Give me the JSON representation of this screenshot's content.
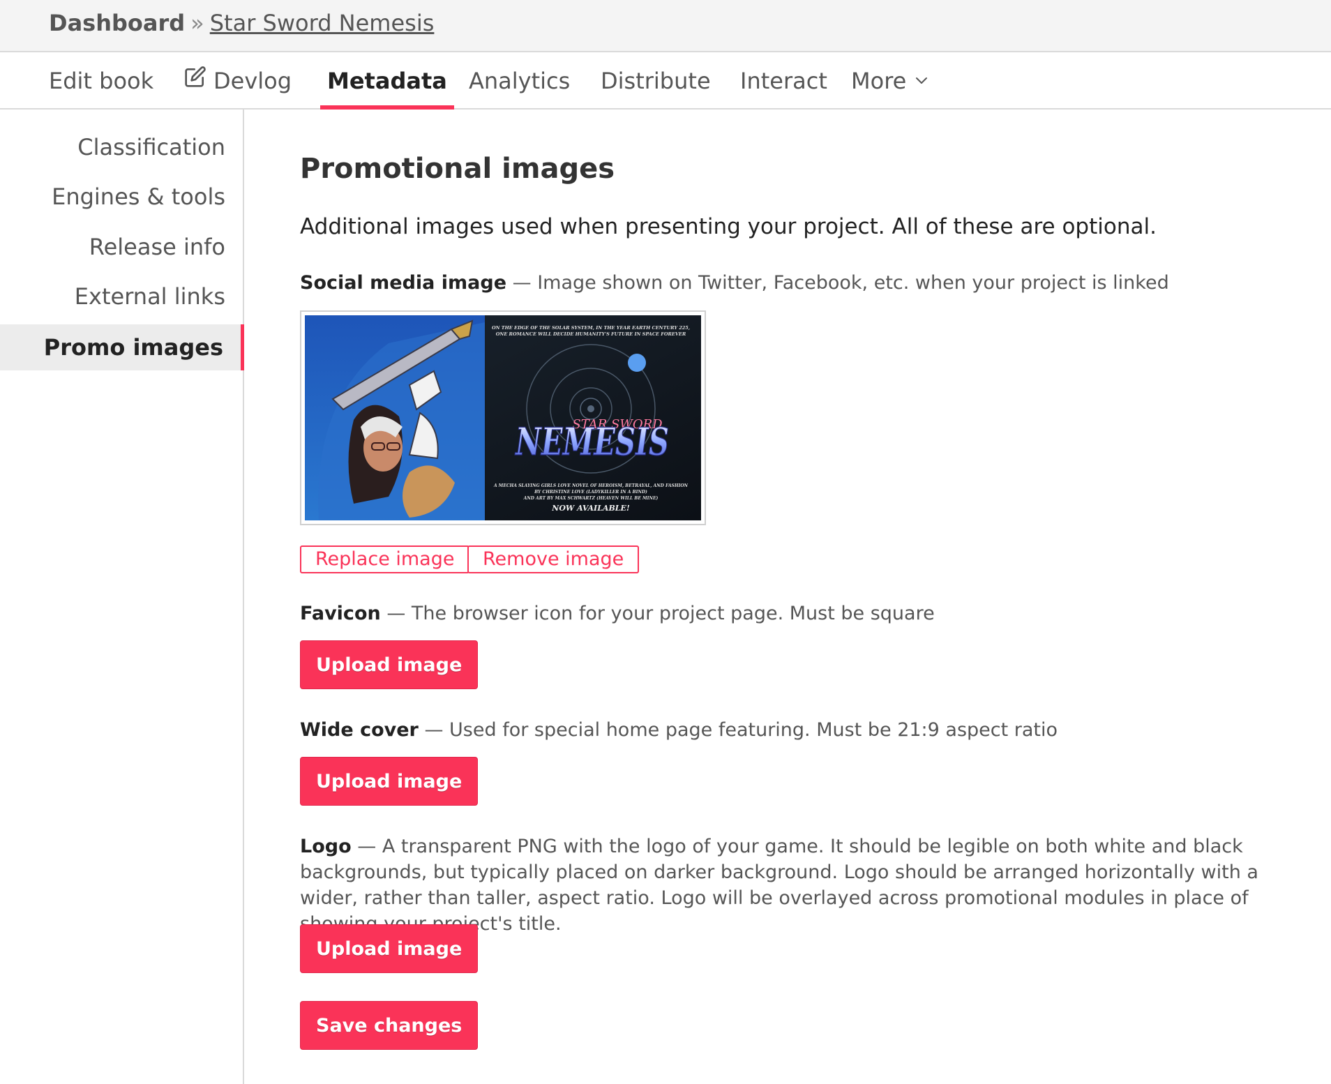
{
  "breadcrumb": {
    "home": "Dashboard",
    "separator": "»",
    "current": "Star Sword Nemesis"
  },
  "tabs": [
    {
      "label": "Edit book",
      "active": false
    },
    {
      "label": "Devlog",
      "active": false,
      "icon": "edit-icon"
    },
    {
      "label": "Metadata",
      "active": true
    },
    {
      "label": "Analytics",
      "active": false
    },
    {
      "label": "Distribute",
      "active": false
    },
    {
      "label": "Interact",
      "active": false
    },
    {
      "label": "More",
      "active": false,
      "icon": "chevron-down-icon"
    }
  ],
  "sidebar": {
    "items": [
      {
        "label": "Classification",
        "active": false
      },
      {
        "label": "Engines & tools",
        "active": false
      },
      {
        "label": "Release info",
        "active": false
      },
      {
        "label": "External links",
        "active": false
      },
      {
        "label": "Promo images",
        "active": true
      }
    ]
  },
  "main": {
    "title": "Promotional images",
    "description": "Additional images used when presenting your project. All of these are optional.",
    "social_media": {
      "name": "Social media image",
      "description": "— Image shown on Twitter, Facebook, etc. when your project is linked",
      "image": {
        "tagline_top_1": "ON THE EDGE OF THE SOLAR SYSTEM, IN THE YEAR EARTH CENTURY 225,",
        "tagline_top_2": "ONE ROMANCE WILL DECIDE HUMANITY'S FUTURE IN SPACE FOREVER",
        "title_small": "STAR SWORD",
        "title_big": "NEMESIS",
        "credit_1": "A MECHA SLAYING GIRLS LOVE NOVEL OF HEROISM, BETRAYAL, AND FASHION",
        "credit_2": "BY CHRISTINE LOVE (LADYKILLER IN A BIND)",
        "credit_3": "AND ART BY MAX SCHWARTZ (HEAVEN WILL BE MINE)",
        "availability": "NOW AVAILABLE!"
      },
      "replace_label": "Replace image",
      "remove_label": "Remove image"
    },
    "favicon": {
      "name": "Favicon",
      "description": "— The browser icon for your project page. Must be square",
      "upload_label": "Upload image"
    },
    "wide_cover": {
      "name": "Wide cover",
      "description": "— Used for special home page featuring. Must be 21:9 aspect ratio",
      "upload_label": "Upload image"
    },
    "logo": {
      "name": "Logo",
      "description": "— A transparent PNG with the logo of your game. It should be legible on both white and black backgrounds, but typically placed on darker background. Logo should be arranged horizontally with a wider, rather than taller, aspect ratio. Logo will be overlayed across promotional modules in place of showing your project's title.",
      "upload_label": "Upload image"
    },
    "save_label": "Save changes"
  },
  "colors": {
    "accent": "#fa3358",
    "text": "#222222",
    "muted_text": "#555555",
    "border": "#dadada",
    "header_bg": "#f4f4f4"
  }
}
